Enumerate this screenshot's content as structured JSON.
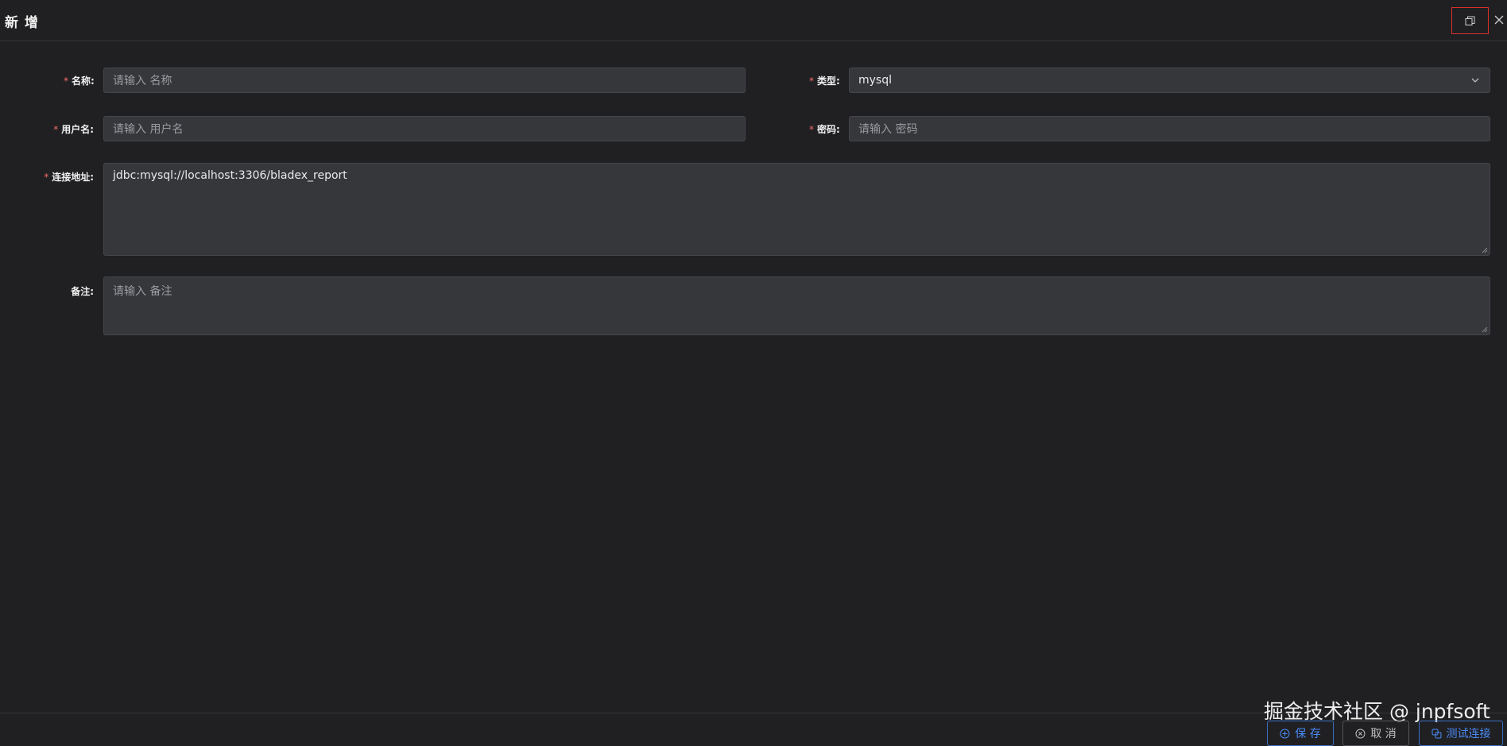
{
  "dialog": {
    "title": "新 增"
  },
  "form": {
    "name": {
      "label": "名称:",
      "placeholder": "请输入 名称"
    },
    "type": {
      "label": "类型:",
      "value": "mysql"
    },
    "username": {
      "label": "用户名:",
      "placeholder": "请输入 用户名"
    },
    "password": {
      "label": "密码:",
      "placeholder": "请输入 密码"
    },
    "url": {
      "label": "连接地址:",
      "value": "jdbc:mysql://localhost:3306/bladex_report"
    },
    "remark": {
      "label": "备注:",
      "placeholder": "请输入 备注"
    },
    "required_mark": "*"
  },
  "footer": {
    "save_label": "保 存",
    "cancel_label": "取 消",
    "test_label": "测试连接"
  },
  "watermark": "掘金技术社区 @ jnpfsoft",
  "colors": {
    "background": "#202023",
    "input_bg": "#36373b",
    "required": "#f56c6c",
    "primary": "#4a8af4",
    "highlight_border": "#d9302c"
  },
  "icons": {
    "fullscreen": "window-restore-icon",
    "close": "close-icon",
    "select": "chevron-down-icon",
    "save": "plus-circle-icon",
    "cancel": "close-circle-icon",
    "test": "link-icon"
  }
}
